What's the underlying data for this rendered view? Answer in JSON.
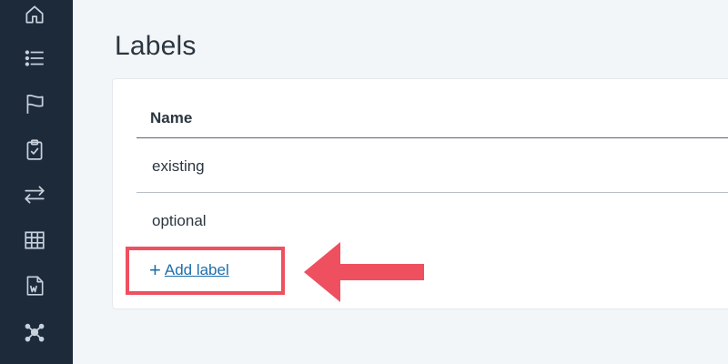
{
  "sidebar": {
    "items": [
      {
        "icon": "home-icon"
      },
      {
        "icon": "list-icon"
      },
      {
        "icon": "flag-icon"
      },
      {
        "icon": "clipboard-check-icon"
      },
      {
        "icon": "swap-arrows-icon"
      },
      {
        "icon": "table-grid-icon"
      },
      {
        "icon": "word-document-icon"
      },
      {
        "icon": "network-nodes-icon"
      }
    ]
  },
  "main": {
    "title": "Labels",
    "table": {
      "column_header": "Name",
      "rows": [
        "existing",
        "optional"
      ]
    },
    "add_label": {
      "plus": "+",
      "text": "Add label"
    }
  },
  "annotation": {
    "color": "#ee5060"
  },
  "colors": {
    "sidebar": "#1d2a3a",
    "link": "#1f6ea8",
    "background": "#f3f6f8"
  }
}
